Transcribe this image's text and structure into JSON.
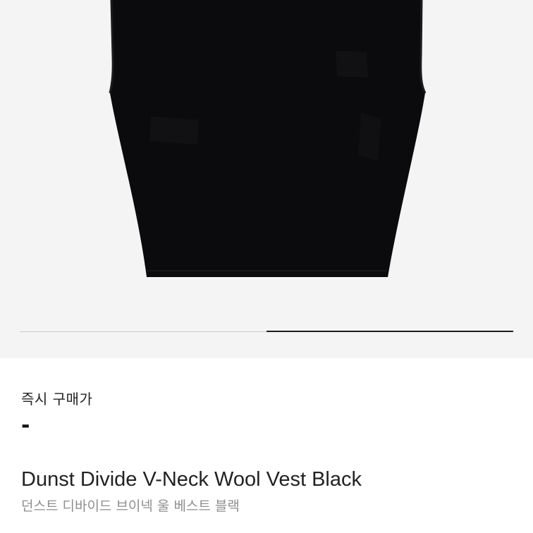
{
  "product_image": {
    "alt": "Dunst Divide V-Neck Wool Vest Black",
    "background": "#f4f4f4",
    "garment_color": "#0b0b0d"
  },
  "image_carousel": {
    "current_page": 2,
    "total_pages": 2,
    "progress": 0.5,
    "track_color": "#c9c9c9",
    "fill_color": "#1e1e1e"
  },
  "price": {
    "label": "즉시 구매가",
    "value": "-"
  },
  "product": {
    "name": "Dunst Divide V-Neck Wool Vest Black",
    "name_ko": "던스트 디바이드 브이넥 울 베스트 블랙"
  }
}
